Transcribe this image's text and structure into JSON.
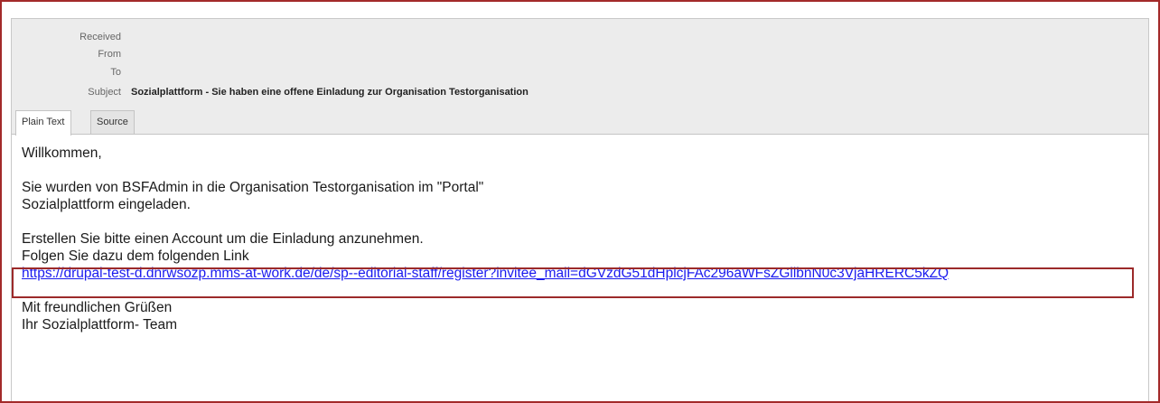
{
  "headers": {
    "received_label": "Received",
    "received_value": "",
    "from_label": "From",
    "from_value": "",
    "to_label": "To",
    "to_value": "",
    "subject_label": "Subject",
    "subject_value": "Sozialplattform - Sie haben eine offene Einladung zur Organisation Testorganisation"
  },
  "tabs": [
    {
      "label": "Plain Text",
      "active": true
    },
    {
      "label": "Source",
      "active": false
    }
  ],
  "body": {
    "greeting": "Willkommen,",
    "line1": "Sie wurden von BSFAdmin in die Organisation Testorganisation im \"Portal\"",
    "line2": "Sozialplattform eingeladen.",
    "line3": "Erstellen Sie bitte einen Account um die Einladung anzunehmen.",
    "line4": "Folgen Sie dazu dem folgenden Link",
    "link": "https://drupal-test-d.dnrwsozp.mms-at-work.de/de/sp--editorial-staff/register?invitee_mail=dGVzdG51dHplcjFAc296aWFsZGllbnN0c3VjaHRERC5kZQ",
    "closing1": "Mit freundlichen Grüßen",
    "closing2": "Ihr Sozialplattform- Team"
  },
  "colors": {
    "highlight_border": "#9c2a2a",
    "link": "#1a1aee",
    "header_bg": "#ececec"
  }
}
